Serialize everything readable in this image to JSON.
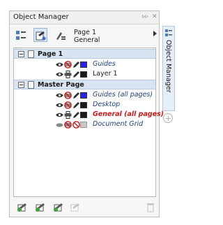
{
  "panel": {
    "title": "Object Manager",
    "controls": {
      "dock_label": "▹▹",
      "close_label": "✕"
    },
    "current_page": {
      "name": "Page 1",
      "layer": "General"
    }
  },
  "tree": {
    "groups": [
      {
        "label": "Page 1",
        "layers": [
          {
            "name": "Guides",
            "color": "#2a23e8",
            "style": "italic-blue",
            "print_icon": "no-print-icon"
          },
          {
            "name": "Layer 1",
            "color": "#1a1a1a",
            "style": "plain",
            "print_icon": "printer-icon"
          }
        ]
      },
      {
        "label": "Master Page",
        "layers": [
          {
            "name": "Guides (all pages)",
            "color": "#2a23e8",
            "style": "italic-blue",
            "print_icon": "no-print-icon"
          },
          {
            "name": "Desktop",
            "color": "#1a1a1a",
            "style": "italic-blue",
            "print_icon": "no-print-icon"
          },
          {
            "name": "General (all pages)",
            "color": "#1a1a1a",
            "style": "red-bold",
            "print_icon": "printer-icon"
          },
          {
            "name": "Document Grid",
            "color": "#c8c8c8",
            "style": "italic-blue",
            "print_icon": "no-print-icon"
          }
        ]
      }
    ]
  },
  "side_tab": {
    "label": "Object Manager"
  },
  "colors": {
    "accent": "#d8e4f2",
    "active_text": "#d01818",
    "link_text": "#1f3f86"
  }
}
